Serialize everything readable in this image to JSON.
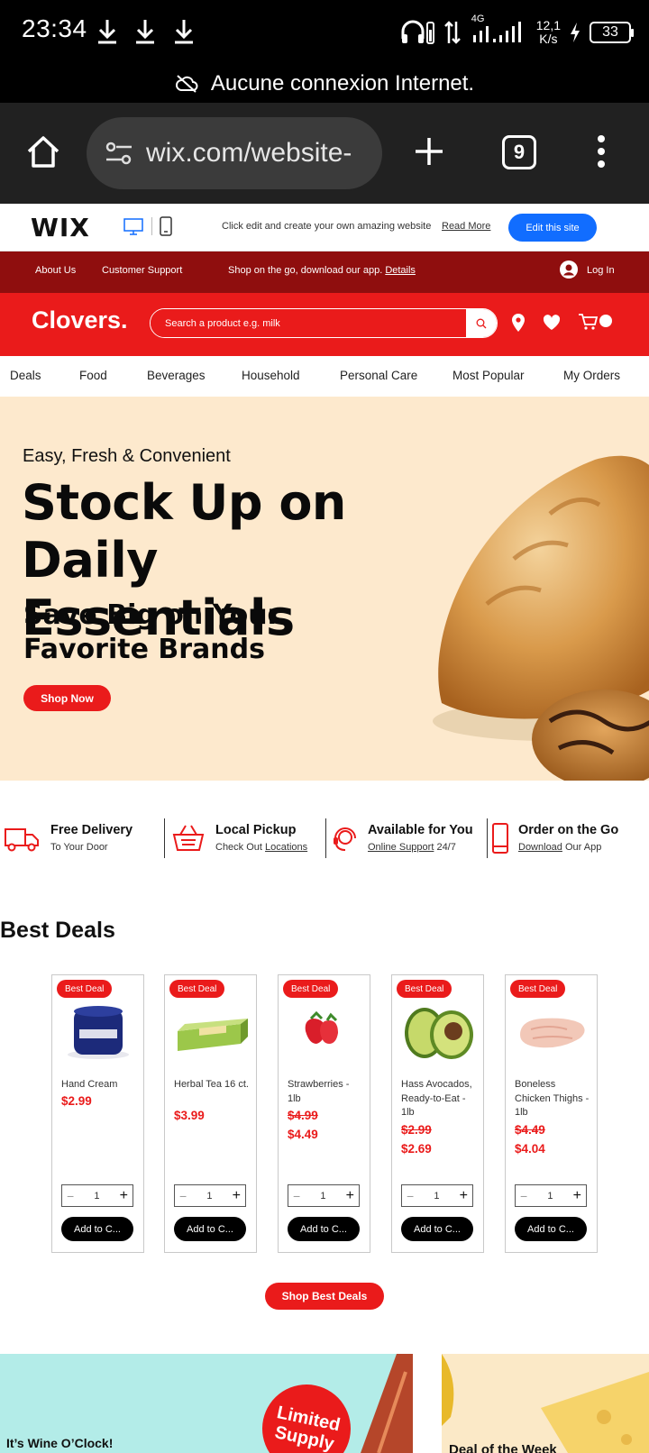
{
  "status_bar": {
    "time": "23:34",
    "network": "4G",
    "speed_top": "12,1",
    "speed_bottom": "K/s",
    "battery": "33"
  },
  "offline_banner": {
    "text": "Aucune connexion Internet."
  },
  "browser": {
    "url": "wix.com/website-",
    "tab_count": "9"
  },
  "wix_bar": {
    "logo": "WIX",
    "message": "Click edit and create your own amazing website",
    "read_more": "Read More",
    "edit_button": "Edit this site"
  },
  "top_nav": {
    "about": "About Us",
    "support": "Customer Support",
    "promo": "Shop on the go, download our app.",
    "promo_link": "Details",
    "login": "Log In"
  },
  "header": {
    "brand": "Clovers.",
    "search_placeholder": "Search a product e.g. milk"
  },
  "categories": [
    "Deals",
    "Food",
    "Beverages",
    "Household",
    "Personal Care",
    "Most Popular",
    "My Orders"
  ],
  "hero": {
    "eyebrow": "Easy, Fresh & Convenient",
    "title": "Stock Up on Daily Essentials",
    "subtitle": "Save Big on Your Favorite Brands",
    "cta": "Shop Now"
  },
  "features": [
    {
      "title": "Free Delivery",
      "pre": "To Your Door",
      "link": "",
      "post": ""
    },
    {
      "title": "Local Pickup",
      "pre": "Check Out ",
      "link": "Locations",
      "post": ""
    },
    {
      "title": "Available for You",
      "pre": "",
      "link": "Online Support",
      "post": " 24/7"
    },
    {
      "title": "Order on the Go",
      "pre": "",
      "link": "Download",
      "post": " Our App"
    }
  ],
  "best_deals": {
    "heading": "Best Deals",
    "badge": "Best Deal",
    "add_to_cart": "Add to C...",
    "cta": "Shop Best Deals",
    "products": [
      {
        "name": "Hand Cream",
        "old_price": "",
        "price": "$2.99",
        "qty": "1"
      },
      {
        "name": "Herbal Tea 16 ct.",
        "old_price": "",
        "price": "$3.99",
        "qty": "1"
      },
      {
        "name": "Strawberries - 1lb",
        "old_price": "$4.99",
        "price": "$4.49",
        "qty": "1"
      },
      {
        "name": "Hass Avocados, Ready-to-Eat - 1lb",
        "old_price": "$2.99",
        "price": "$2.69",
        "qty": "1"
      },
      {
        "name": "Boneless Chicken Thighs - 1lb",
        "old_price": "$4.49",
        "price": "$4.04",
        "qty": "1"
      }
    ]
  },
  "promos": {
    "wine": "It’s Wine O’Clock!",
    "limited": "Limited Supply",
    "deal_week": "Deal of the Week"
  },
  "colors": {
    "brand_red": "#ea1b1b",
    "dark_red": "#8f0e0e",
    "wix_blue": "#116dff",
    "hero_bg": "#fde9cd"
  }
}
